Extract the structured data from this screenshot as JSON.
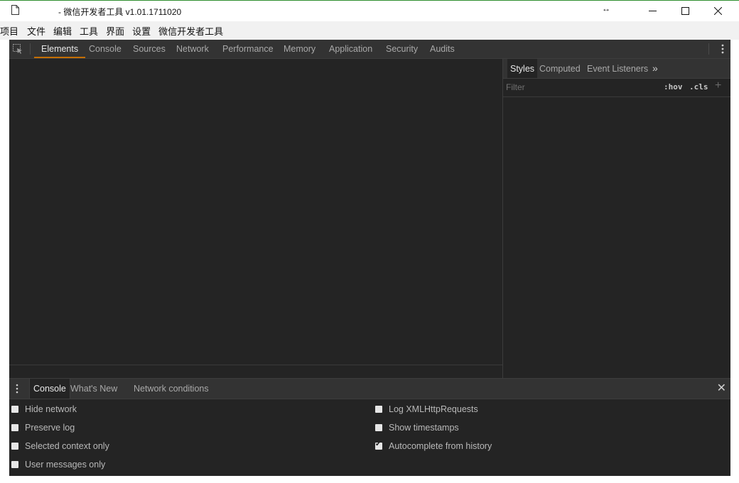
{
  "window": {
    "title": "- 微信开发者工具 v1.01.1711020",
    "resize_glyph": "↔",
    "minimize_glyph": "—",
    "close_glyph": "✕"
  },
  "menu": [
    "项目",
    "文件",
    "编辑",
    "工具",
    "界面",
    "设置",
    "微信开发者工具"
  ],
  "devtools": {
    "tabs": [
      "Elements",
      "Console",
      "Sources",
      "Network",
      "Performance",
      "Memory",
      "Application",
      "Security",
      "Audits"
    ],
    "active_tab": "Elements",
    "accent_color": "#c46f00"
  },
  "styles_pane": {
    "tabs": [
      "Styles",
      "Computed",
      "Event Listeners"
    ],
    "more": "»",
    "filter_placeholder": "Filter",
    "hov": ":hov",
    "cls": ".cls",
    "add": "+"
  },
  "drawer": {
    "tabs": [
      "Console",
      "What's New",
      "Network conditions"
    ],
    "close": "✕",
    "options_left": [
      {
        "label": "Hide network",
        "checked": false
      },
      {
        "label": "Preserve log",
        "checked": false
      },
      {
        "label": "Selected context only",
        "checked": false
      },
      {
        "label": "User messages only",
        "checked": false
      }
    ],
    "options_right": [
      {
        "label": "Log XMLHttpRequests",
        "checked": false
      },
      {
        "label": "Show timestamps",
        "checked": false
      },
      {
        "label": "Autocomplete from history",
        "checked": true
      }
    ]
  }
}
